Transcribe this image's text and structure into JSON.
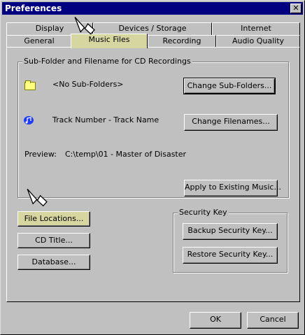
{
  "window": {
    "title": "Preferences",
    "close_symbol": "✕"
  },
  "tabs": {
    "row_back": [
      "Display",
      "Devices / Storage",
      "Internet"
    ],
    "row_front": [
      "General",
      "Music Files",
      "Recording",
      "Audio Quality"
    ],
    "selected": "Music Files"
  },
  "subfolder_group": {
    "label": "Sub-Folder and Filename for CD Recordings",
    "subfolder_value": "<No Sub-Folders>",
    "change_subfolders_label": "Change Sub-Folders...",
    "filename_value": "Track Number - Track Name",
    "change_filenames_label": "Change Filenames...",
    "preview_label": "Preview:",
    "preview_value": "C:\\temp\\01 - Master of Disaster",
    "apply_label": "Apply to Existing Music..."
  },
  "left_buttons": {
    "file_locations": "File Locations...",
    "cd_title": "CD Title...",
    "database": "Database..."
  },
  "security_group": {
    "label": "Security Key",
    "backup_label": "Backup Security Key...",
    "restore_label": "Restore Security Key..."
  },
  "footer": {
    "ok_label": "OK",
    "cancel_label": "Cancel"
  },
  "icons": [
    "folder-icon",
    "music-note-icon",
    "pointer-arrow-icon",
    "close-icon"
  ],
  "colors": {
    "titlebar": "#000080",
    "face": "#c0c0c0",
    "highlight": "#d6d6a0"
  }
}
